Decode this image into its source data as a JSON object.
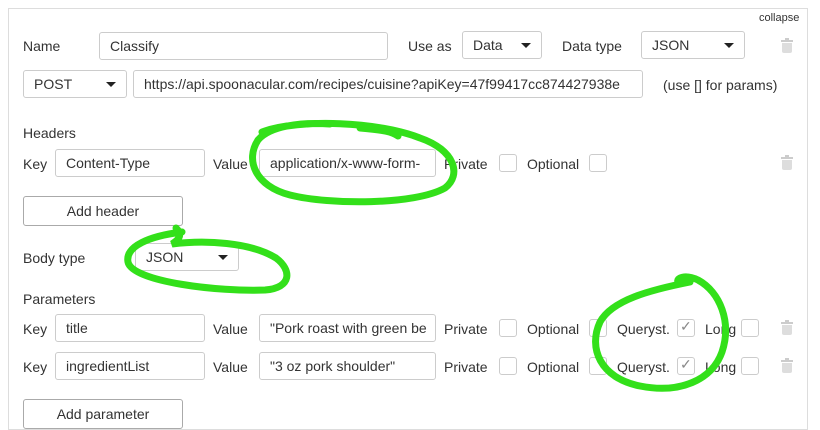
{
  "collapse_label": "collapse",
  "row1": {
    "name_label": "Name",
    "name_value": "Classify",
    "use_as_label": "Use as",
    "use_as_value": "Data",
    "data_type_label": "Data type",
    "data_type_value": "JSON"
  },
  "row2": {
    "method_value": "POST",
    "url_value": "https://api.spoonacular.com/recipes/cuisine?apiKey=47f99417cc874427938e",
    "params_hint": "(use [] for params)"
  },
  "headers": {
    "section_label": "Headers",
    "key_label": "Key",
    "key_value": "Content-Type",
    "value_label": "Value",
    "value_value": "application/x-www-form-",
    "private_label": "Private",
    "optional_label": "Optional",
    "add_button": "Add header"
  },
  "body": {
    "label": "Body type",
    "value": "JSON"
  },
  "parameters": {
    "section_label": "Parameters",
    "rows": [
      {
        "key_label": "Key",
        "key_value": "title",
        "value_label": "Value",
        "value_value": "\"Pork roast with green be",
        "private_label": "Private",
        "optional_label": "Optional",
        "queryst_label": "Queryst.",
        "long_label": "Long",
        "queryst_checked": true
      },
      {
        "key_label": "Key",
        "key_value": "ingredientList",
        "value_label": "Value",
        "value_value": "\"3 oz pork shoulder\"",
        "private_label": "Private",
        "optional_label": "Optional",
        "queryst_label": "Queryst.",
        "long_label": "Long",
        "queryst_checked": true
      }
    ],
    "add_button": "Add parameter"
  },
  "colors": {
    "highlight": "#33e01a",
    "border": "#cccccc"
  }
}
